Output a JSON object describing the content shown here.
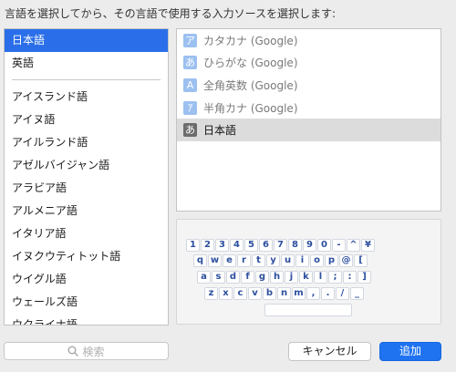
{
  "prompt": "言語を選択してから、その言語で使用する入力ソースを選択します:",
  "languages": {
    "top": [
      "日本語",
      "英語"
    ],
    "rest": [
      "アイスランド語",
      "アイヌ語",
      "アイルランド語",
      "アゼルバイジャン語",
      "アラビア語",
      "アルメニア語",
      "イタリア語",
      "イヌクウティトット語",
      "ウイグル語",
      "ウェールズ語",
      "ウクライナ語"
    ],
    "selected": "日本語"
  },
  "sources": [
    {
      "icon": "ア",
      "label": "カタカナ (Google)",
      "icon_name": "katakana-icon"
    },
    {
      "icon": "あ",
      "label": "ひらがな (Google)",
      "icon_name": "hiragana-icon"
    },
    {
      "icon": "A",
      "label": "全角英数 (Google)",
      "icon_name": "fullwidth-alnum-icon"
    },
    {
      "icon": "ｱ",
      "label": "半角カナ (Google)",
      "icon_name": "halfwidth-kana-icon"
    },
    {
      "icon": "あ",
      "label": "日本語",
      "icon_name": "japanese-icon"
    }
  ],
  "keyboard": {
    "row1": [
      "1",
      "2",
      "3",
      "4",
      "5",
      "6",
      "7",
      "8",
      "9",
      "0",
      "-",
      "^",
      "¥"
    ],
    "row2": [
      "q",
      "w",
      "e",
      "r",
      "t",
      "y",
      "u",
      "i",
      "o",
      "p",
      "@",
      "["
    ],
    "row3": [
      "a",
      "s",
      "d",
      "f",
      "g",
      "h",
      "j",
      "k",
      "l",
      ";",
      ":",
      "]"
    ],
    "row4": [
      "z",
      "x",
      "c",
      "v",
      "b",
      "n",
      "m",
      ",",
      ".",
      "/",
      "_"
    ]
  },
  "search": {
    "placeholder": "検索"
  },
  "buttons": {
    "cancel": "キャンセル",
    "add": "追加"
  },
  "colors": {
    "accent": "#2a6ee9",
    "add_button": "#1f73f0",
    "key_text": "#2c4f9e"
  }
}
